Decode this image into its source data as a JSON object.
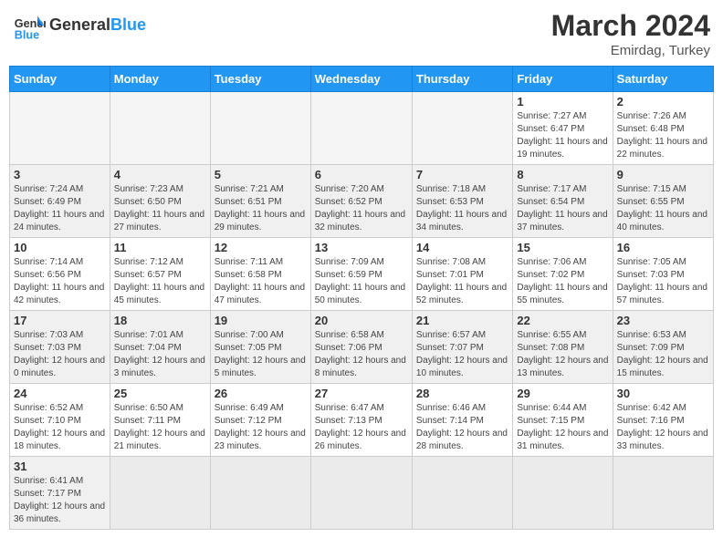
{
  "header": {
    "logo_general": "General",
    "logo_blue": "Blue",
    "month_year": "March 2024",
    "location": "Emirdag, Turkey"
  },
  "days_of_week": [
    "Sunday",
    "Monday",
    "Tuesday",
    "Wednesday",
    "Thursday",
    "Friday",
    "Saturday"
  ],
  "weeks": [
    [
      {
        "day": "",
        "info": ""
      },
      {
        "day": "",
        "info": ""
      },
      {
        "day": "",
        "info": ""
      },
      {
        "day": "",
        "info": ""
      },
      {
        "day": "",
        "info": ""
      },
      {
        "day": "1",
        "info": "Sunrise: 7:27 AM\nSunset: 6:47 PM\nDaylight: 11 hours and 19 minutes."
      },
      {
        "day": "2",
        "info": "Sunrise: 7:26 AM\nSunset: 6:48 PM\nDaylight: 11 hours and 22 minutes."
      }
    ],
    [
      {
        "day": "3",
        "info": "Sunrise: 7:24 AM\nSunset: 6:49 PM\nDaylight: 11 hours and 24 minutes."
      },
      {
        "day": "4",
        "info": "Sunrise: 7:23 AM\nSunset: 6:50 PM\nDaylight: 11 hours and 27 minutes."
      },
      {
        "day": "5",
        "info": "Sunrise: 7:21 AM\nSunset: 6:51 PM\nDaylight: 11 hours and 29 minutes."
      },
      {
        "day": "6",
        "info": "Sunrise: 7:20 AM\nSunset: 6:52 PM\nDaylight: 11 hours and 32 minutes."
      },
      {
        "day": "7",
        "info": "Sunrise: 7:18 AM\nSunset: 6:53 PM\nDaylight: 11 hours and 34 minutes."
      },
      {
        "day": "8",
        "info": "Sunrise: 7:17 AM\nSunset: 6:54 PM\nDaylight: 11 hours and 37 minutes."
      },
      {
        "day": "9",
        "info": "Sunrise: 7:15 AM\nSunset: 6:55 PM\nDaylight: 11 hours and 40 minutes."
      }
    ],
    [
      {
        "day": "10",
        "info": "Sunrise: 7:14 AM\nSunset: 6:56 PM\nDaylight: 11 hours and 42 minutes."
      },
      {
        "day": "11",
        "info": "Sunrise: 7:12 AM\nSunset: 6:57 PM\nDaylight: 11 hours and 45 minutes."
      },
      {
        "day": "12",
        "info": "Sunrise: 7:11 AM\nSunset: 6:58 PM\nDaylight: 11 hours and 47 minutes."
      },
      {
        "day": "13",
        "info": "Sunrise: 7:09 AM\nSunset: 6:59 PM\nDaylight: 11 hours and 50 minutes."
      },
      {
        "day": "14",
        "info": "Sunrise: 7:08 AM\nSunset: 7:01 PM\nDaylight: 11 hours and 52 minutes."
      },
      {
        "day": "15",
        "info": "Sunrise: 7:06 AM\nSunset: 7:02 PM\nDaylight: 11 hours and 55 minutes."
      },
      {
        "day": "16",
        "info": "Sunrise: 7:05 AM\nSunset: 7:03 PM\nDaylight: 11 hours and 57 minutes."
      }
    ],
    [
      {
        "day": "17",
        "info": "Sunrise: 7:03 AM\nSunset: 7:03 PM\nDaylight: 12 hours and 0 minutes."
      },
      {
        "day": "18",
        "info": "Sunrise: 7:01 AM\nSunset: 7:04 PM\nDaylight: 12 hours and 3 minutes."
      },
      {
        "day": "19",
        "info": "Sunrise: 7:00 AM\nSunset: 7:05 PM\nDaylight: 12 hours and 5 minutes."
      },
      {
        "day": "20",
        "info": "Sunrise: 6:58 AM\nSunset: 7:06 PM\nDaylight: 12 hours and 8 minutes."
      },
      {
        "day": "21",
        "info": "Sunrise: 6:57 AM\nSunset: 7:07 PM\nDaylight: 12 hours and 10 minutes."
      },
      {
        "day": "22",
        "info": "Sunrise: 6:55 AM\nSunset: 7:08 PM\nDaylight: 12 hours and 13 minutes."
      },
      {
        "day": "23",
        "info": "Sunrise: 6:53 AM\nSunset: 7:09 PM\nDaylight: 12 hours and 15 minutes."
      }
    ],
    [
      {
        "day": "24",
        "info": "Sunrise: 6:52 AM\nSunset: 7:10 PM\nDaylight: 12 hours and 18 minutes."
      },
      {
        "day": "25",
        "info": "Sunrise: 6:50 AM\nSunset: 7:11 PM\nDaylight: 12 hours and 21 minutes."
      },
      {
        "day": "26",
        "info": "Sunrise: 6:49 AM\nSunset: 7:12 PM\nDaylight: 12 hours and 23 minutes."
      },
      {
        "day": "27",
        "info": "Sunrise: 6:47 AM\nSunset: 7:13 PM\nDaylight: 12 hours and 26 minutes."
      },
      {
        "day": "28",
        "info": "Sunrise: 6:46 AM\nSunset: 7:14 PM\nDaylight: 12 hours and 28 minutes."
      },
      {
        "day": "29",
        "info": "Sunrise: 6:44 AM\nSunset: 7:15 PM\nDaylight: 12 hours and 31 minutes."
      },
      {
        "day": "30",
        "info": "Sunrise: 6:42 AM\nSunset: 7:16 PM\nDaylight: 12 hours and 33 minutes."
      }
    ],
    [
      {
        "day": "31",
        "info": "Sunrise: 6:41 AM\nSunset: 7:17 PM\nDaylight: 12 hours and 36 minutes."
      },
      {
        "day": "",
        "info": ""
      },
      {
        "day": "",
        "info": ""
      },
      {
        "day": "",
        "info": ""
      },
      {
        "day": "",
        "info": ""
      },
      {
        "day": "",
        "info": ""
      },
      {
        "day": "",
        "info": ""
      }
    ]
  ]
}
